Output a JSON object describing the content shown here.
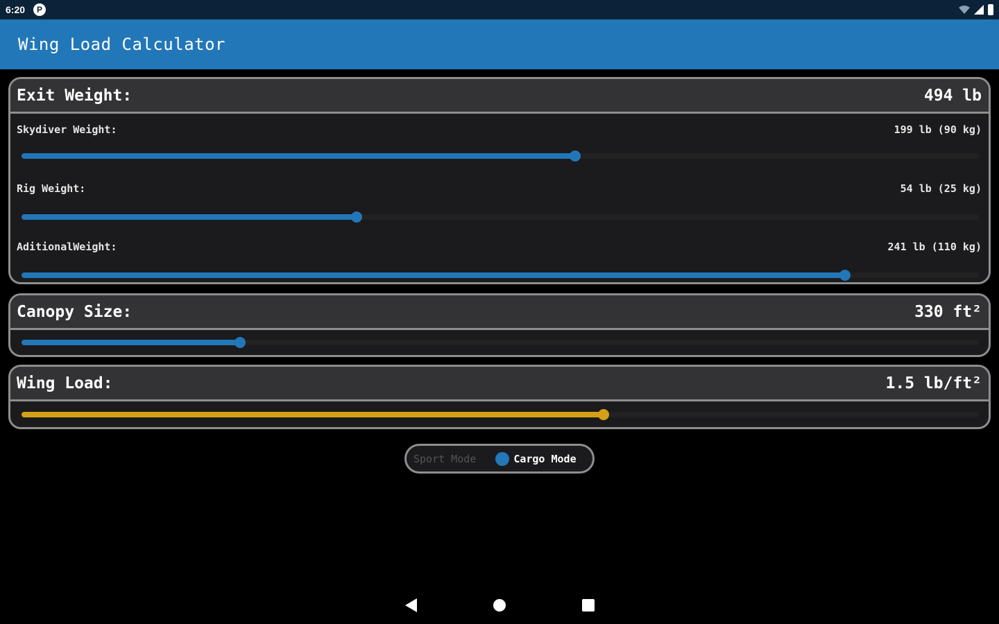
{
  "status_bar": {
    "time": "6:20",
    "app_icon_glyph": "P",
    "icons": [
      "wifi-icon",
      "signal-icon",
      "battery-icon"
    ]
  },
  "app_bar": {
    "title": "Wing Load Calculator"
  },
  "exit_weight": {
    "label": "Exit Weight:",
    "value": "494 lb",
    "rows": [
      {
        "label": "Skydiver Weight:",
        "value": "199 lb (90 kg)",
        "fraction": 0.578
      },
      {
        "label": "Rig Weight:",
        "value": "54 lb (25 kg)",
        "fraction": 0.35
      },
      {
        "label": "AditionalWeight:",
        "value": "241 lb (110 kg)",
        "fraction": 0.86
      }
    ]
  },
  "canopy_size": {
    "label": "Canopy Size:",
    "value": "330 ft²",
    "fraction": 0.228
  },
  "wing_load": {
    "label": "Wing Load:",
    "value": "1.5 lb/ft²",
    "fraction": 0.608
  },
  "mode_toggle": {
    "sport_label": "Sport Mode",
    "cargo_label": "Cargo Mode",
    "selected": "Cargo Mode"
  },
  "colors": {
    "accent": "#2277b8",
    "wing_load": "#d4a017",
    "status_bar": "#0b2238"
  }
}
